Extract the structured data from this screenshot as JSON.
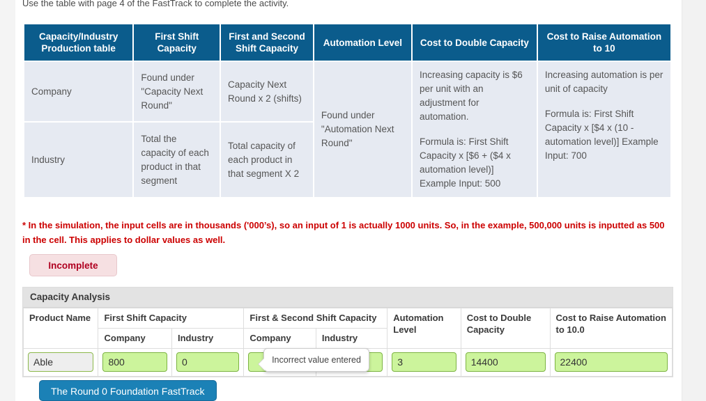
{
  "intro": {
    "text": "Use the table with page 4 of the FastTrack to complete the activity."
  },
  "reference_table": {
    "headers": [
      "Capacity/Industry Production table",
      "First Shift Capacity",
      "First and Second Shift Capacity",
      "Automation Level",
      "Cost to Double Capacity",
      "Cost to Raise Automation to 10"
    ],
    "rows": [
      {
        "label": "Company",
        "first_shift": "Found under \"Capacity Next Round\"",
        "both_shifts": "Capacity Next Round x 2 (shifts)",
        "automation": "Found under \"Automation Next Round\"",
        "cost_double_p1": "Increasing capacity is $6 per unit with an adjustment for automation.",
        "cost_double_p2": "Formula is: First Shift Capacity x [$6 + ($4 x automation level)] Example Input: 500",
        "cost_raise_p1": "Increasing automation is per unit of capacity",
        "cost_raise_p2": "Formula is: First Shift Capacity x [$4 x (10 - automation level)] Example Input: 700"
      },
      {
        "label": "Industry",
        "first_shift": "Total the capacity of each product in that segment",
        "both_shifts": "Total capacity of each product in that segment X 2"
      }
    ]
  },
  "note": {
    "text": "* In the simulation, the input cells are in thousands ('000’s), so an input of 1 is actually 1000 units. So, in the example, 500,000 units is inputted as 500 in the cell. This applies to dollar values as well."
  },
  "status_badge": {
    "label": "Incomplete"
  },
  "capacity_analysis": {
    "title": "Capacity Analysis",
    "headers": {
      "product_name": "Product Name",
      "first_shift_capacity": "First Shift Capacity",
      "first_second_shift_capacity": "First & Second Shift Capacity",
      "automation_level": "Automation Level",
      "cost_to_double_capacity": "Cost to Double Capacity",
      "cost_to_raise_automation": "Cost to Raise Automation to 10.0"
    },
    "subheaders": {
      "fs_company": "Company",
      "fs_industry": "Industry",
      "ss_company": "Company",
      "ss_industry": "Industry"
    },
    "rows": [
      {
        "product_name": "Able",
        "fs_company": "800",
        "fs_industry": "0",
        "ss_company": "",
        "ss_industry": "",
        "automation_level": "3",
        "cost_to_double_capacity": "14400",
        "cost_to_raise_automation": "22400"
      }
    ]
  },
  "tooltip": {
    "text": "Incorrect value entered"
  },
  "footer_button": {
    "label": "The Round 0 Foundation FastTrack"
  },
  "colors": {
    "header_blue": "#0b5c8c",
    "cell_blue_gray": "#e6eaf2",
    "note_red": "#cc0000",
    "badge_bg": "#f6e0e2",
    "badge_text": "#b00020",
    "input_green": "#ccf49c",
    "input_green_border": "#7cb342",
    "button_blue": "#1b81b6"
  }
}
